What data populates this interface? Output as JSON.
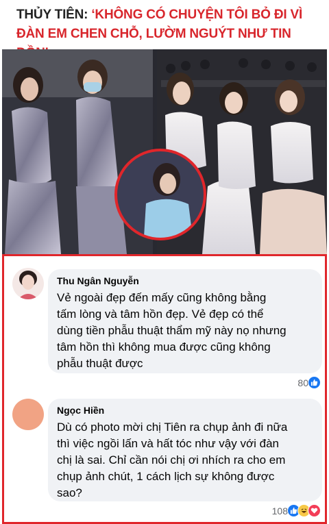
{
  "headline": {
    "prefix": "THỦY TIÊN: ",
    "quote_line1": "‘KHÔNG CÓ CHUYỆN TÔI BỎ ĐI VÌ",
    "quote_line2": "ĐÀN EM CHEN CHỖ, LƯỜM NGUÝT NHƯ TIN ĐỒN’"
  },
  "colors": {
    "headline_red": "#d8262c",
    "border_red": "#e0262b",
    "bubble_bg": "#f0f2f5",
    "like_blue": "#1877f2"
  },
  "comments": [
    {
      "author": "Thu Ngân Nguyễn",
      "lines": [
        "Vẻ ngoài đẹp đến mấy cũng không bằng",
        "tấm lòng và tâm hồn đẹp. Vẻ đẹp có thể",
        "dùng tiền phẫu thuật thẩm mỹ này nọ nhưng",
        "tâm hồn thì không mua được cũng không",
        "phẫu thuật được"
      ],
      "reaction_count": "80",
      "reaction_icons": [
        "like-icon"
      ]
    },
    {
      "author": "Ngọc Hiền",
      "lines": [
        "Dù có photo mời chị Tiên ra chụp ảnh đi nữa",
        "thì việc ngồi lấn và hất tóc như vậy với đàn",
        "chị là sai. Chỉ cần nói chị ơi nhích ra cho em",
        "chụp ảnh chút, 1 cách lịch sự không được",
        "sao?"
      ],
      "reaction_count": "108",
      "reaction_icons": [
        "like-icon",
        "haha-icon",
        "love-icon"
      ]
    }
  ]
}
